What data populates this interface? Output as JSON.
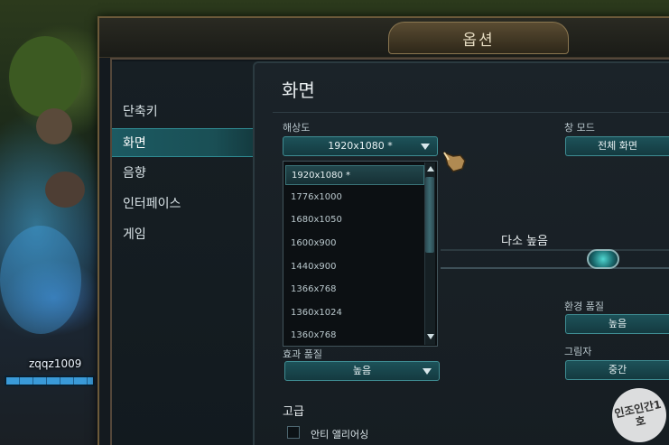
{
  "window": {
    "title": "옵션"
  },
  "sidebar": {
    "items": [
      {
        "label": "단축키"
      },
      {
        "label": "화면"
      },
      {
        "label": "음향"
      },
      {
        "label": "인터페이스"
      },
      {
        "label": "게임"
      }
    ],
    "active_index": 1
  },
  "panel": {
    "title": "화면",
    "resolution": {
      "label": "해상도",
      "value": "1920x1080 *",
      "options": [
        "1920x1080 *",
        "1776x1000",
        "1680x1050",
        "1600x900",
        "1440x900",
        "1366x768",
        "1360x1024",
        "1360x768"
      ]
    },
    "window_mode": {
      "label": "창 모드",
      "value": "전체 화면"
    },
    "overall_quality": {
      "value": "다소 높음"
    },
    "environment_quality": {
      "label": "환경 품질",
      "value": "높음"
    },
    "shadows": {
      "label": "그림자",
      "value": "중간"
    },
    "effects_quality": {
      "label": "효과 품질",
      "value": "높음"
    },
    "advanced": {
      "title": "고급",
      "anti_aliasing": {
        "label": "안티 앨리어싱",
        "checked": false
      }
    }
  },
  "hud": {
    "player_name": "zqqz1009",
    "health_fraction": 0.98
  },
  "watermark": "인조인간1호",
  "colors": {
    "accent": "#3f8d93",
    "active_tab": "#1c5a62",
    "frame_gold": "#6c5a3a"
  }
}
